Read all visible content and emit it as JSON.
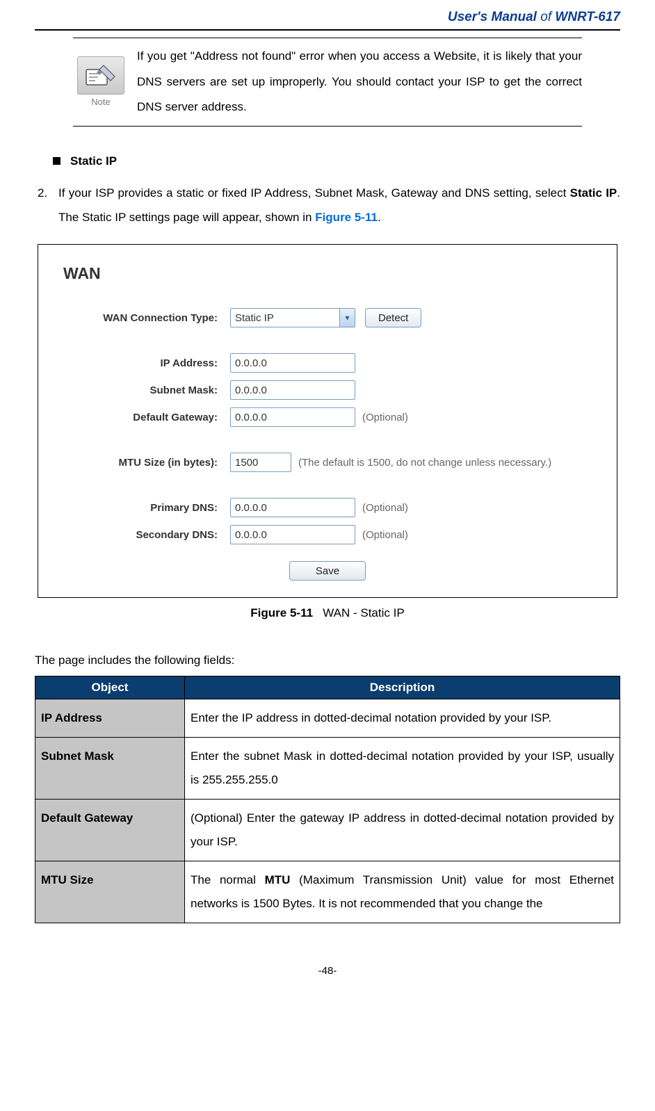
{
  "header": {
    "title_prefix": "User's Manual",
    "title_of": "of",
    "title_model": "WNRT-617"
  },
  "note": {
    "label": "Note",
    "text": "If you get \"Address not found\" error when you access a Website, it is likely that your DNS servers are set up improperly. You should contact your ISP to get the correct DNS server address."
  },
  "bullet_heading": "Static IP",
  "step": {
    "num": "2.",
    "text_front": "If your ISP provides a static or fixed IP Address, Subnet Mask, Gateway and DNS setting, select ",
    "bold1": "Static IP",
    "text_mid": ". The Static IP settings page will appear, shown in ",
    "fig_link": "Figure 5-11",
    "text_end": "."
  },
  "screenshot": {
    "heading": "WAN",
    "labels": {
      "conn_type": "WAN Connection Type:",
      "ip": "IP Address:",
      "subnet": "Subnet Mask:",
      "gateway": "Default Gateway:",
      "mtu": "MTU Size (in bytes):",
      "pdns": "Primary DNS:",
      "sdns": "Secondary DNS:"
    },
    "values": {
      "conn_type": "Static IP",
      "ip": "0.0.0.0",
      "subnet": "0.0.0.0",
      "gateway": "0.0.0.0",
      "mtu": "1500",
      "pdns": "0.0.0.0",
      "sdns": "0.0.0.0"
    },
    "buttons": {
      "detect": "Detect",
      "save": "Save"
    },
    "hints": {
      "optional": "(Optional)",
      "mtu": "(The default is 1500, do not change unless necessary.)"
    }
  },
  "figure_caption": {
    "bold": "Figure 5-11",
    "rest": "WAN - Static IP"
  },
  "fields_intro": "The page includes the following fields:",
  "fields_table": {
    "headers": {
      "object": "Object",
      "desc": "Description"
    },
    "rows": [
      {
        "object": "IP Address",
        "desc": "Enter the IP address in dotted-decimal notation provided by your ISP."
      },
      {
        "object": "Subnet Mask",
        "desc": "Enter the subnet Mask in dotted-decimal notation provided by your ISP, usually is 255.255.255.0"
      },
      {
        "object": "Default Gateway",
        "desc": "(Optional) Enter the gateway IP address in dotted-decimal notation provided by your ISP."
      },
      {
        "object": "MTU Size",
        "desc_pre": "The normal ",
        "desc_bold": "MTU",
        "desc_post": " (Maximum Transmission Unit) value for most Ethernet networks is 1500 Bytes. It is not recommended that you change the"
      }
    ]
  },
  "page_number": "-48-"
}
